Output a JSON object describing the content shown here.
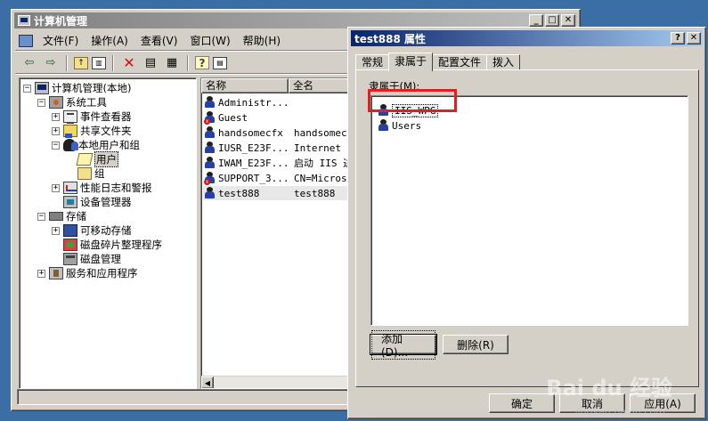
{
  "main_window": {
    "title": "计算机管理",
    "menu": [
      "文件(F)",
      "操作(A)",
      "查看(V)",
      "窗口(W)",
      "帮助(H)"
    ],
    "caption_buttons": [
      "_",
      "□",
      "✕"
    ],
    "tree": [
      {
        "label": "计算机管理(本地)",
        "icon": "computer-icon",
        "expander": "−",
        "indent": 0
      },
      {
        "label": "系统工具",
        "icon": "tools-icon",
        "expander": "−",
        "indent": 1
      },
      {
        "label": "事件查看器",
        "icon": "event-viewer-icon",
        "expander": "+",
        "indent": 2
      },
      {
        "label": "共享文件夹",
        "icon": "shared-folder-icon",
        "expander": "+",
        "indent": 2
      },
      {
        "label": "本地用户和组",
        "icon": "users-groups-icon",
        "expander": "−",
        "indent": 2
      },
      {
        "label": "用户",
        "icon": "folder-open-icon",
        "expander": "",
        "indent": 3,
        "selected": true
      },
      {
        "label": "组",
        "icon": "folder-icon",
        "expander": "",
        "indent": 3
      },
      {
        "label": "性能日志和警报",
        "icon": "performance-icon",
        "expander": "+",
        "indent": 2
      },
      {
        "label": "设备管理器",
        "icon": "device-manager-icon",
        "expander": "",
        "indent": 2
      },
      {
        "label": "存储",
        "icon": "storage-icon",
        "expander": "−",
        "indent": 1
      },
      {
        "label": "可移动存储",
        "icon": "removable-storage-icon",
        "expander": "+",
        "indent": 2
      },
      {
        "label": "磁盘碎片整理程序",
        "icon": "defrag-icon",
        "expander": "",
        "indent": 2
      },
      {
        "label": "磁盘管理",
        "icon": "disk-management-icon",
        "expander": "",
        "indent": 2
      },
      {
        "label": "服务和应用程序",
        "icon": "services-icon",
        "expander": "+",
        "indent": 1
      }
    ],
    "list_columns": [
      "名称",
      "全名"
    ],
    "users": [
      {
        "name": "Administr...",
        "full": "",
        "disabled": false
      },
      {
        "name": "Guest",
        "full": "",
        "disabled": true
      },
      {
        "name": "handsomecfx",
        "full": "handsomecfx",
        "disabled": false
      },
      {
        "name": "IUSR_E23F...",
        "full": "Internet 来",
        "disabled": false
      },
      {
        "name": "IWAM_E23F...",
        "full": "启动 IIS 进",
        "disabled": false
      },
      {
        "name": "SUPPORT_3...",
        "full": "CN=Microso",
        "disabled": true
      },
      {
        "name": "test888",
        "full": "test888",
        "disabled": false,
        "selected": true
      }
    ]
  },
  "dialog": {
    "title": "test888 属性",
    "caption_buttons": [
      "?",
      "✕"
    ],
    "tabs": [
      "常规",
      "隶属于",
      "配置文件",
      "拨入"
    ],
    "active_tab": 1,
    "group_label": "隶属于(M):",
    "members": [
      {
        "name": "IIS_WPG",
        "focused": true
      },
      {
        "name": "Users",
        "focused": false
      }
    ],
    "add_button": "添加(D)...",
    "remove_button": "删除(R)",
    "ok_button": "确定",
    "cancel_button": "取消",
    "apply_button": "应用(A)"
  },
  "watermark": {
    "text": "Bai du 经验",
    "sub": "jingyan.baidu.com"
  },
  "colors": {
    "desktop": "#3a6ea5",
    "active_title": "#0a246a",
    "inactive_title": "#808080",
    "highlight": "#e02020"
  }
}
